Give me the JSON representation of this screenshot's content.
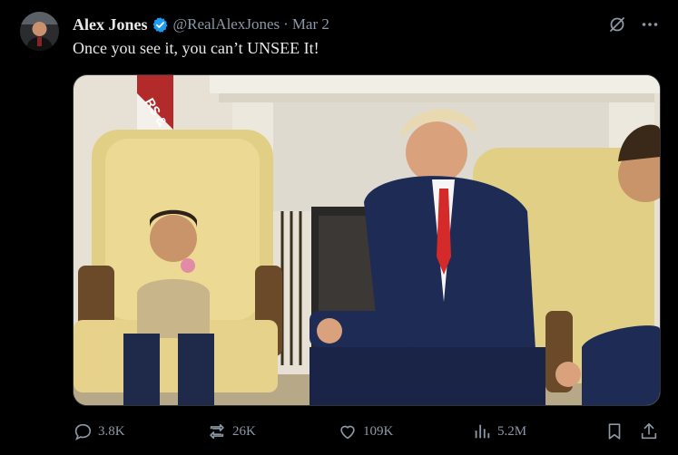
{
  "author": {
    "name": "Alex Jones",
    "handle": "@RealAlexJones",
    "separator": "·",
    "date": "Mar 2"
  },
  "tweet": {
    "text": "Once you see it, you can’t UNSEE It!"
  },
  "media": {
    "flag_text": "RS &"
  },
  "top_icons": [
    "grok-icon",
    "more-icon"
  ],
  "actions": {
    "replies": "3.8K",
    "reposts": "26K",
    "likes": "109K",
    "views": "5.2M"
  },
  "colors": {
    "background": "#000000",
    "text": "#e7e9ea",
    "muted": "#8b98a5",
    "verified": "#1d9bf0"
  }
}
